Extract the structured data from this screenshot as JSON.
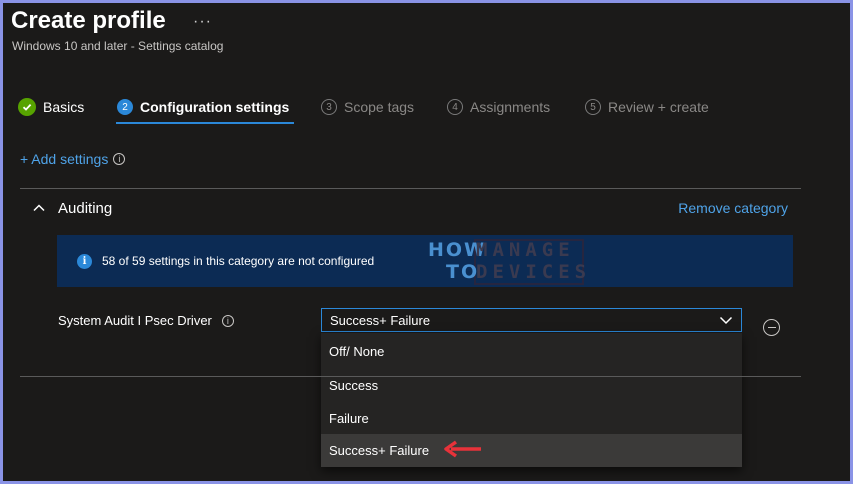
{
  "header": {
    "title": "Create profile",
    "more": "···",
    "subtitle": "Windows 10 and later - Settings catalog"
  },
  "tabs": [
    {
      "label": "Basics",
      "state": "completed"
    },
    {
      "label": "Configuration settings",
      "number": "2",
      "state": "active"
    },
    {
      "label": "Scope tags",
      "number": "3",
      "state": "pending"
    },
    {
      "label": "Assignments",
      "number": "4",
      "state": "pending"
    },
    {
      "label": "Review + create",
      "number": "5",
      "state": "pending"
    }
  ],
  "add_settings": {
    "label": "+ Add settings",
    "info": "i"
  },
  "category": {
    "title": "Auditing",
    "remove_label": "Remove category"
  },
  "banner": {
    "icon": "i",
    "text": "58 of 59 settings in this category are not configured"
  },
  "watermark": {
    "how": "HOW",
    "to": "TO",
    "manage": "MANAGE",
    "devices": "DEVICES"
  },
  "setting": {
    "label": "System Audit I Psec Driver",
    "info": "i",
    "selected_value": "Success+ Failure",
    "options": [
      "Off/ None",
      "Success",
      "Failure",
      "Success+ Failure"
    ]
  },
  "colors": {
    "accent": "#2b88d8",
    "link": "#4fa3e8",
    "success": "#57a300",
    "banner_bg": "#0c2b54",
    "arrow": "#e8323a"
  }
}
